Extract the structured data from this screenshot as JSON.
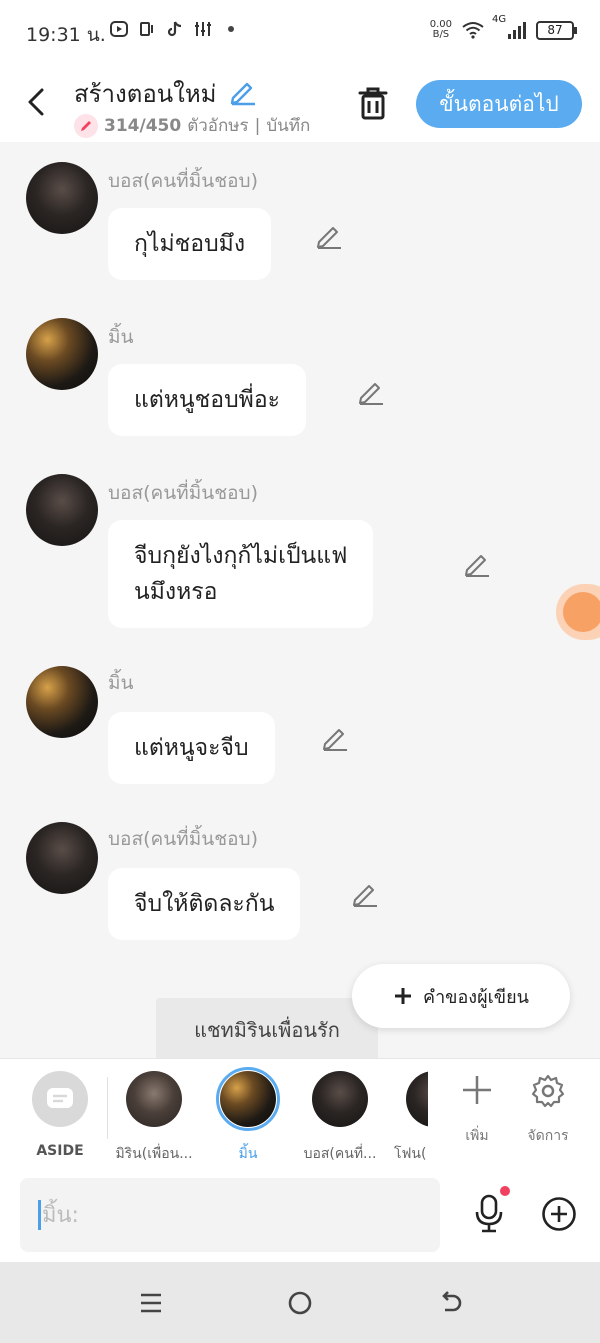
{
  "status_bar": {
    "time": "19:31 น.",
    "speed_value": "0.00",
    "speed_unit": "B/S",
    "network": "4G",
    "battery": "87"
  },
  "header": {
    "title": "สร้างตอนใหม่",
    "char_count": "314/450",
    "char_unit": "ตัวอักษร",
    "separator": "|",
    "save_label": "บันทึก",
    "next_label": "ขั้นตอนต่อไป"
  },
  "messages": [
    {
      "speaker": "บอส(คนที่มิ้นชอบ)",
      "text": "กุไม่ชอบมึง"
    },
    {
      "speaker": "มิ้น",
      "text": "แต่หนูชอบพี่อะ"
    },
    {
      "speaker": "บอส(คนที่มิ้นชอบ)",
      "text_line1": "จีบกุยังไงกุก้ไม่เป็นแฟ",
      "text_line2": "นมึงหรอ"
    },
    {
      "speaker": "มิ้น",
      "text": "แต่หนูจะจีบ"
    },
    {
      "speaker": "บอส(คนที่มิ้นชอบ)",
      "text": "จีบให้ติดละกัน"
    }
  ],
  "chat_title_tag": "แชทมิรินเพื่อนรัก",
  "author_button": "คำของผู้เขียน",
  "characters": {
    "aside_label": "ASIDE",
    "items": [
      {
        "label": "มิริน(เพื่อน..."
      },
      {
        "label": "มิ้น"
      },
      {
        "label": "บอส(คนที่..."
      },
      {
        "label": "โฟน("
      }
    ],
    "add_label": "เพิ่ม",
    "manage_label": "จัดการ"
  },
  "input": {
    "placeholder": "มิ้น:"
  },
  "colors": {
    "accent": "#5aabf0",
    "selected_label": "#4a9fe8",
    "notification_dot": "#f24060"
  }
}
